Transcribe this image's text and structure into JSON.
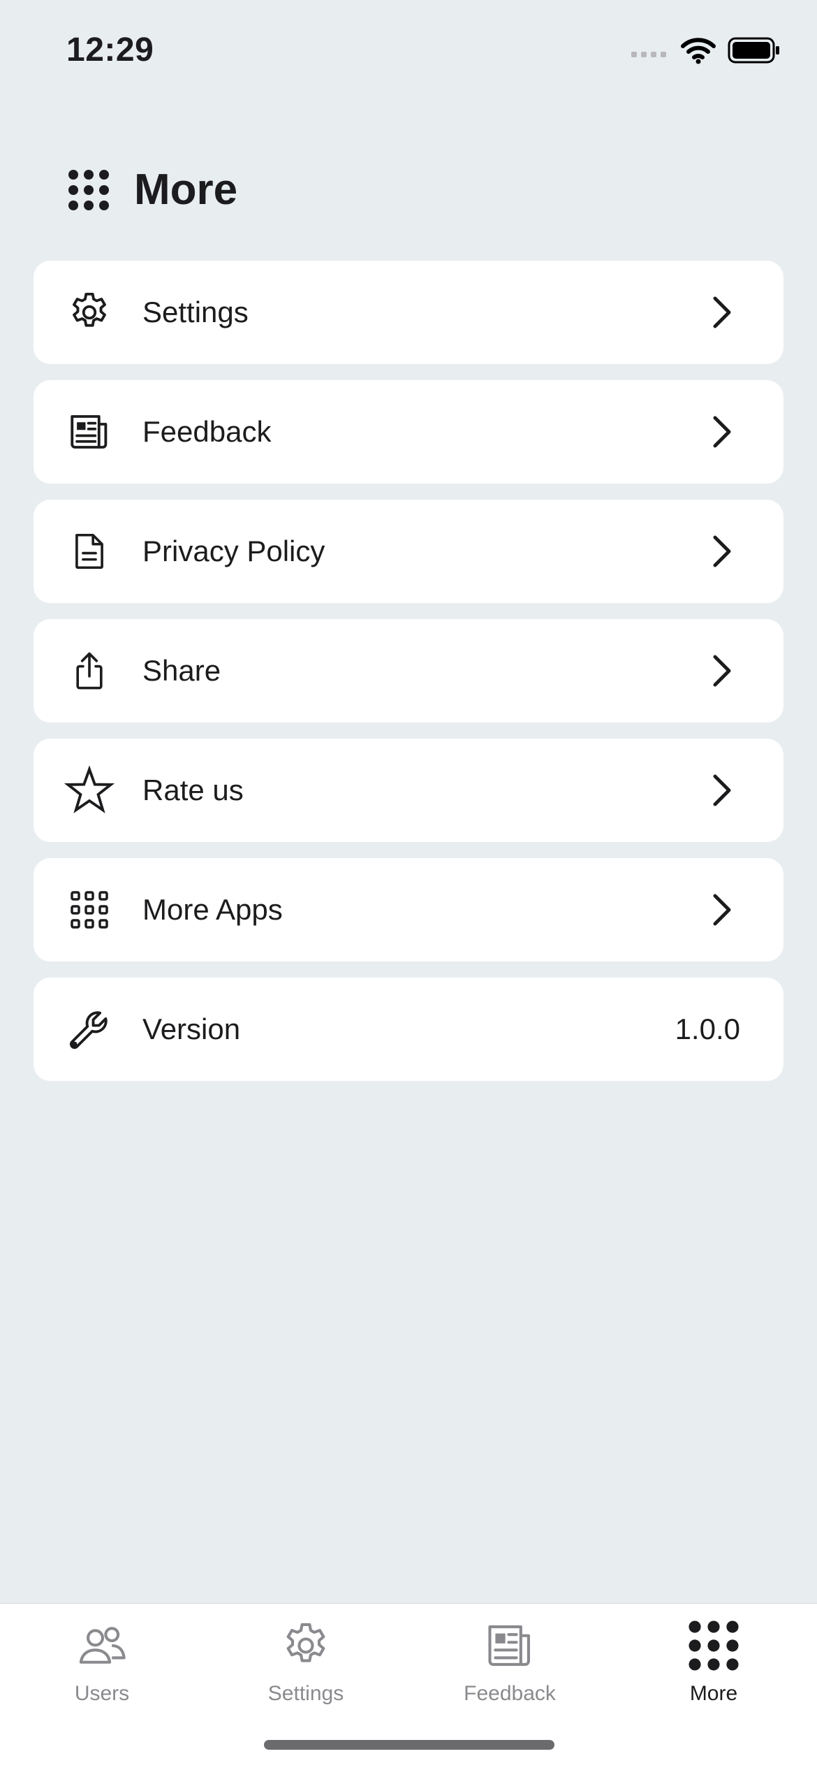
{
  "status_bar": {
    "time": "12:29"
  },
  "header": {
    "title": "More",
    "icon": "grid-dots-icon"
  },
  "menu": [
    {
      "label": "Settings",
      "icon": "gear-icon",
      "has_chevron": true
    },
    {
      "label": "Feedback",
      "icon": "newspaper-icon",
      "has_chevron": true
    },
    {
      "label": "Privacy Policy",
      "icon": "document-icon",
      "has_chevron": true
    },
    {
      "label": "Share",
      "icon": "share-icon",
      "has_chevron": true
    },
    {
      "label": "Rate us",
      "icon": "star-icon",
      "has_chevron": true
    },
    {
      "label": "More Apps",
      "icon": "apps-grid-icon",
      "has_chevron": true
    },
    {
      "label": "Version",
      "icon": "wrench-icon",
      "value": "1.0.0",
      "has_chevron": false
    }
  ],
  "tab_bar": {
    "tabs": [
      {
        "label": "Users",
        "icon": "users-icon",
        "active": false
      },
      {
        "label": "Settings",
        "icon": "gear-icon",
        "active": false
      },
      {
        "label": "Feedback",
        "icon": "newspaper-icon",
        "active": false
      },
      {
        "label": "More",
        "icon": "grid-dots-icon",
        "active": true
      }
    ]
  },
  "colors": {
    "background": "#e8edf0",
    "card": "#ffffff",
    "text": "#1c1c1e",
    "inactive_tab": "#8a8a8e"
  }
}
